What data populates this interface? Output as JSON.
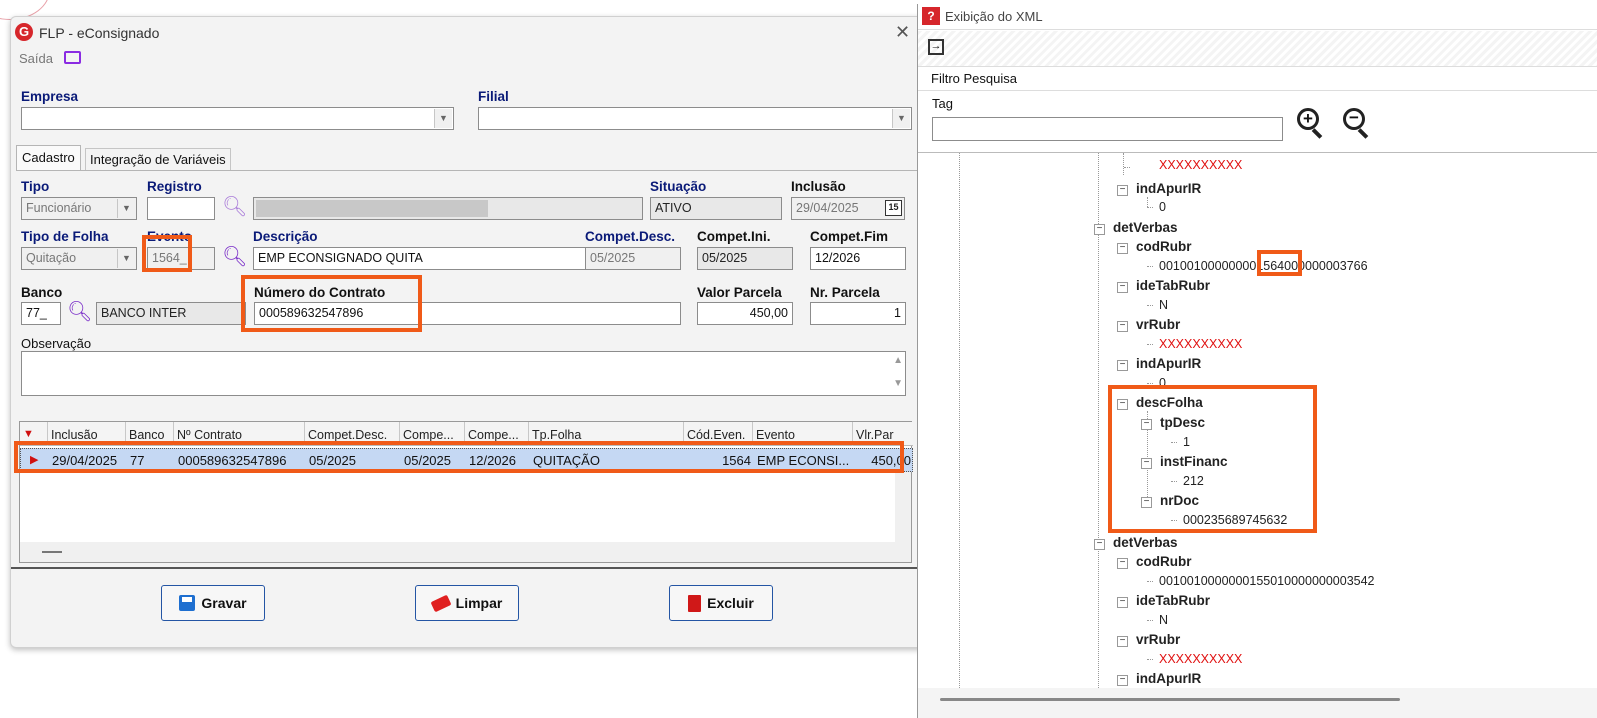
{
  "left_window": {
    "title": "FLP - eConsignado",
    "saida_label": "Saída",
    "empresa_label": "Empresa",
    "filial_label": "Filial",
    "tabs": [
      "Cadastro",
      "Integração de Variáveis"
    ],
    "fields": {
      "tipo_label": "Tipo",
      "tipo_value": "Funcionário",
      "registro_label": "Registro",
      "situacao_label": "Situação",
      "situacao_value": "ATIVO",
      "inclusao_label": "Inclusão",
      "inclusao_value": "29/04/2025",
      "tipo_folha_label": "Tipo de Folha",
      "tipo_folha_value": "Quitação",
      "evento_label": "Evento",
      "evento_value": "1564_",
      "descricao_label": "Descrição",
      "descricao_value": "EMP ECONSIGNADO QUITA",
      "compet_desc_label": "Compet.Desc.",
      "compet_desc_value": "05/2025",
      "compet_ini_label": "Compet.Ini.",
      "compet_ini_value": "05/2025",
      "compet_fim_label": "Compet.Fim",
      "compet_fim_value": "12/2026",
      "banco_label": "Banco",
      "banco_value": "77_",
      "banco_nome": "BANCO INTER",
      "contrato_label": "Número do Contrato",
      "contrato_value": "000589632547896",
      "valor_parcela_label": "Valor Parcela",
      "valor_parcela_value": "450,00",
      "nr_parcela_label": "Nr. Parcela",
      "nr_parcela_value": "1",
      "observacao_label": "Observação"
    },
    "grid": {
      "headers": [
        "Inclusão",
        "Banco",
        "Nº Contrato",
        "Compet.Desc.",
        "Compe...",
        "Compe...",
        "Tp.Folha",
        "Cód.Even.",
        "Evento",
        "Vlr.Par"
      ],
      "row": [
        "29/04/2025",
        "77",
        "000589632547896",
        "05/2025",
        "05/2025",
        "12/2026",
        "QUITAÇÃO",
        "1564",
        "EMP ECONSI...",
        "450,00"
      ]
    },
    "buttons": {
      "gravar": "Gravar",
      "limpar": "Limpar",
      "excluir": "Excluir"
    }
  },
  "xml_window": {
    "title": "Exibição do XML",
    "filtro_label": "Filtro Pesquisa",
    "tag_label": "Tag",
    "tree": {
      "n0_val": "XXXXXXXXXX",
      "n1": "indApurIR",
      "n1_val": "0",
      "n2": "detVerbas",
      "n3": "codRubr",
      "n3_val_a": "00100100000000",
      "n3_val_hl": "1564",
      "n3_val_b": "000000003766",
      "n4": "ideTabRubr",
      "n4_val": "N",
      "n5": "vrRubr",
      "n5_val": "XXXXXXXXXX",
      "n6": "indApurIR",
      "n6_val": "0",
      "n7": "descFolha",
      "n8": "tpDesc",
      "n8_val": "1",
      "n9": "instFinanc",
      "n9_val": "212",
      "n10": "nrDoc",
      "n10_val": "000235689745632",
      "n11": "detVerbas",
      "n12": "codRubr",
      "n12_val": "0010010000000155010000000003542",
      "n13": "ideTabRubr",
      "n13_val": "N",
      "n14": "vrRubr",
      "n14_val": "XXXXXXXXXX",
      "n15": "indApurIR"
    }
  }
}
